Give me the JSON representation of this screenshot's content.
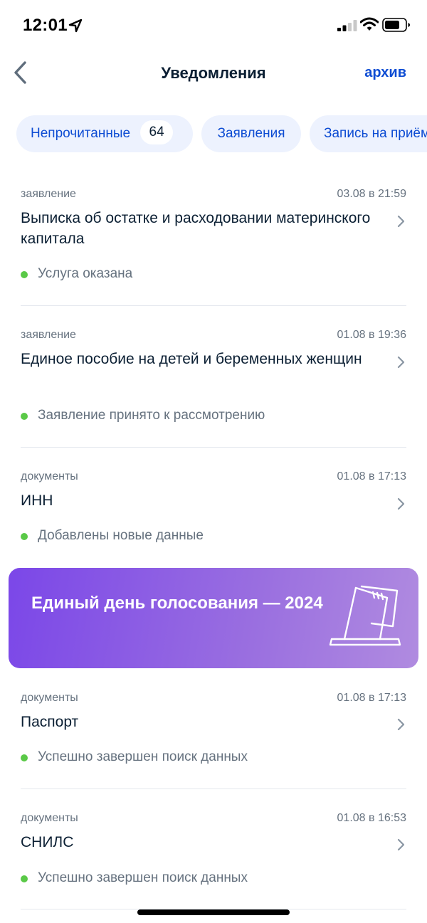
{
  "status_bar": {
    "time": "12:01",
    "icons": [
      "location-arrow-icon",
      "cellular-signal-icon",
      "wifi-icon",
      "battery-icon"
    ]
  },
  "nav": {
    "title": "Уведомления",
    "archive_label": "архив",
    "back_icon": "chevron-left-icon"
  },
  "chips": [
    {
      "label": "Непрочитанные",
      "count": "64"
    },
    {
      "label": "Заявления"
    },
    {
      "label": "Запись на приём"
    }
  ],
  "notifications_top": [
    {
      "category": "заявление",
      "date": "03.08 в 21:59",
      "title": "Выписка об остатке и расходовании материнского капитала",
      "status": "Услуга оказана"
    },
    {
      "category": "заявление",
      "date": "01.08 в 19:36",
      "title": "Единое пособие на детей и беременных женщин",
      "status": "Заявление принято к рассмотрению"
    },
    {
      "category": "документы",
      "date": "01.08 в 17:13",
      "title": "ИНН",
      "status": "Добавлены новые данные"
    }
  ],
  "banner": {
    "text": "Единый день голосования — 2024",
    "icon": "ballot-box-icon"
  },
  "notifications_bottom": [
    {
      "category": "документы",
      "date": "01.08 в 17:13",
      "title": "Паспорт",
      "status": "Успешно завершен поиск данных"
    },
    {
      "category": "документы",
      "date": "01.08 в 16:53",
      "title": "СНИЛС",
      "status": "Успешно завершен поиск данных"
    }
  ],
  "colors": {
    "accent": "#0d4cd3",
    "chip_bg": "#edf2fe",
    "status_dot": "#5ac947",
    "banner_start": "#7b47e8",
    "banner_end": "#b08be0"
  }
}
